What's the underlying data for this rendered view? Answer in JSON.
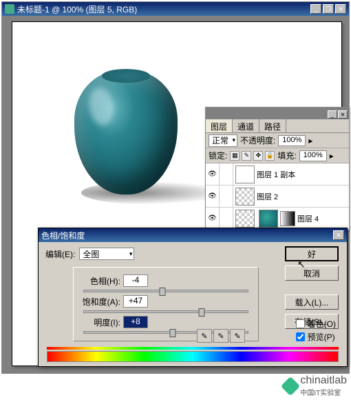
{
  "document": {
    "title": "未标题-1 @ 100% (图层 5, RGB)"
  },
  "layers_panel": {
    "tabs": [
      "图层",
      "通道",
      "路径"
    ],
    "blend_mode": "正常",
    "opacity_label": "不透明度:",
    "opacity_value": "100%",
    "lock_label": "锁定:",
    "fill_label": "填充:",
    "fill_value": "100%",
    "layers": [
      {
        "name": "图层 1 副本",
        "visible": true
      },
      {
        "name": "图层 2",
        "visible": true
      },
      {
        "name": "图层 4",
        "visible": true
      }
    ]
  },
  "dialog": {
    "title": "色相/饱和度",
    "edit_label": "编辑(E):",
    "edit_value": "全图",
    "sliders": {
      "hue": {
        "label": "色相(H):",
        "value": "-4",
        "pos": 48
      },
      "saturation": {
        "label": "饱和度(A):",
        "value": "+47",
        "pos": 72
      },
      "lightness": {
        "label": "明度(I):",
        "value": "+8",
        "pos": 54
      }
    },
    "buttons": {
      "ok": "好",
      "cancel": "取消",
      "load": "载入(L)...",
      "save": "存储(S)..."
    },
    "colorize_label": "着色(O)",
    "preview_label": "预览(P)",
    "colorize_checked": false,
    "preview_checked": true
  },
  "watermark": {
    "brand": "chinaitlab",
    "sub": "中国IT实验室"
  }
}
